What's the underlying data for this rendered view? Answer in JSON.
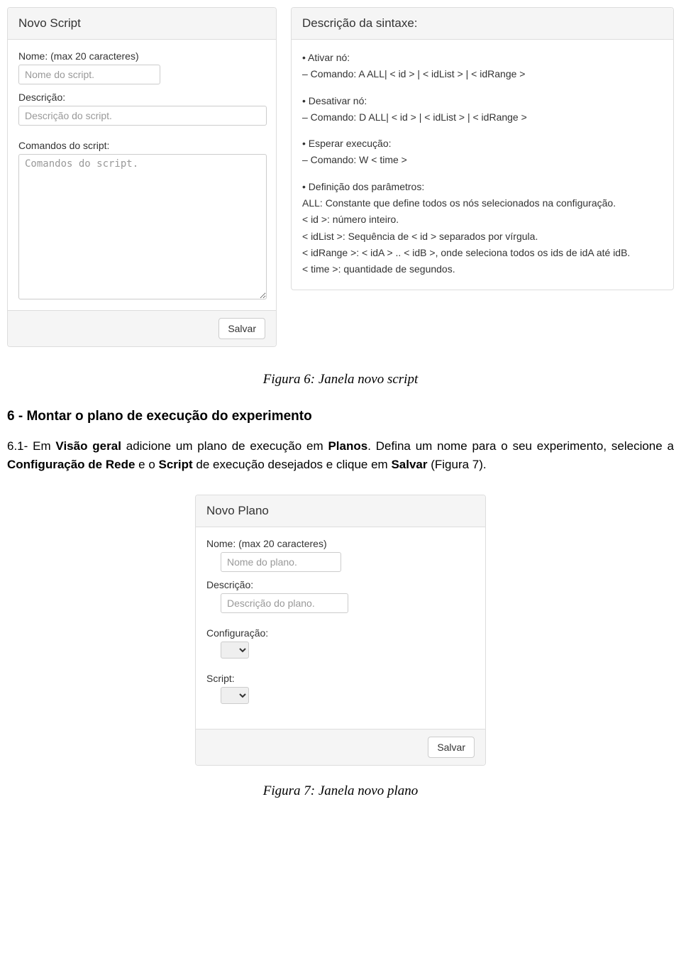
{
  "novoScript": {
    "title": "Novo Script",
    "nomeLabel": "Nome: (max 20 caracteres)",
    "nomePlaceholder": "Nome do script.",
    "descLabel": "Descrição:",
    "descPlaceholder": "Descrição do script.",
    "cmdLabel": "Comandos do script:",
    "cmdPlaceholder": "Comandos do script.",
    "saveLabel": "Salvar"
  },
  "syntax": {
    "title": "Descrição da sintaxe:",
    "lines": [
      "• Ativar nó:",
      "– Comando: A ALL| < id > | < idList > | < idRange >",
      "",
      "• Desativar nó:",
      "– Comando: D ALL| < id > | < idList > | < idRange >",
      "",
      "• Esperar execução:",
      "– Comando: W < time >",
      "",
      "• Definição dos parâmetros:",
      "ALL: Constante que define todos os nós selecionados na configuração.",
      "< id >: número inteiro.",
      "< idList >: Sequência de < id > separados por vírgula.",
      "< idRange >: < idA > .. < idB >, onde seleciona todos os ids de idA até idB.",
      "< time >: quantidade de segundos."
    ]
  },
  "figure6": "Figura 6: Janela novo script",
  "sectionHeading": "6 - Montar o plano de execução do experimento",
  "bodyText": {
    "p1a": "6.1- Em ",
    "b1": "Visão geral",
    "p1b": " adicione um plano de execução em ",
    "b2": "Planos",
    "p1c": ". Defina um nome para o seu experimento, selecione a ",
    "b3": "Configuração de Rede",
    "p1d": " e o ",
    "b4": "Script",
    "p1e": " de execução desejados e clique em ",
    "b5": "Salvar",
    "p1f": " (Figura 7)."
  },
  "novoPlano": {
    "title": "Novo Plano",
    "nomeLabel": "Nome: (max 20 caracteres)",
    "nomePlaceholder": "Nome do plano.",
    "descLabel": "Descrição:",
    "descPlaceholder": "Descrição do plano.",
    "configLabel": "Configuração:",
    "scriptLabel": "Script:",
    "saveLabel": "Salvar"
  },
  "figure7": "Figura 7: Janela novo plano"
}
